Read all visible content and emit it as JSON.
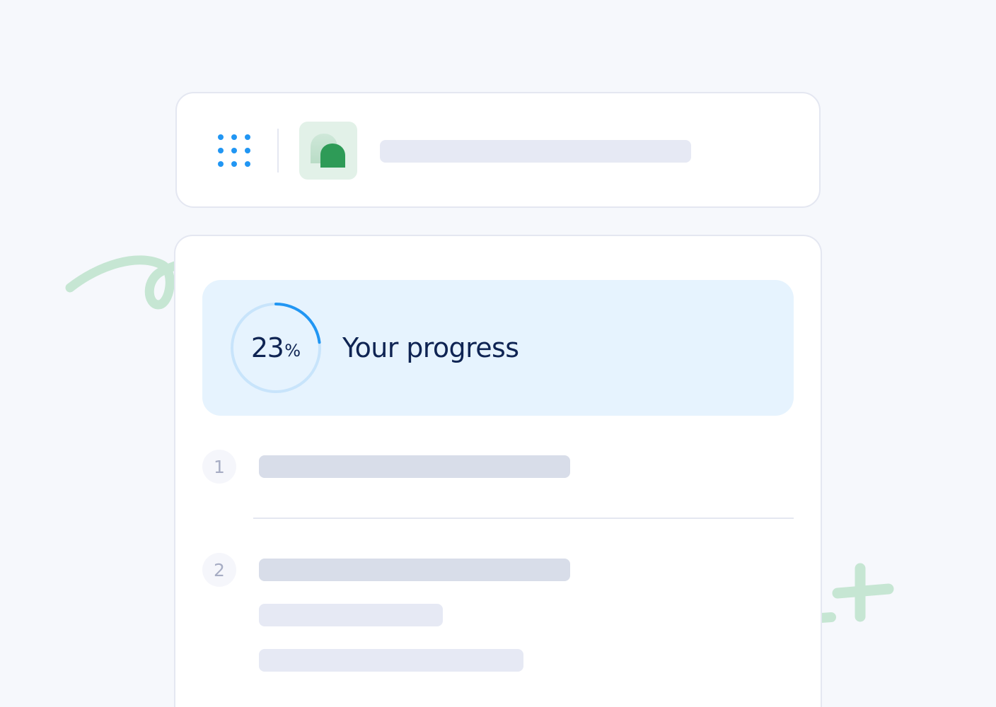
{
  "colors": {
    "page_background": "#f6f8fc",
    "card_background": "#ffffff",
    "card_border": "#e4e7f1",
    "accent_blue": "#2196f3",
    "ring_track": "#c8e4fb",
    "progress_panel": "#e6f3fe",
    "heading_text": "#0f2453",
    "skeleton_dark": "#d8dde9",
    "skeleton_light": "#e6e9f4",
    "badge_background": "#f5f6fb",
    "badge_text": "#a7adc4",
    "brand_green": "#2e9b57",
    "brand_green_light": "#e2f1e8",
    "decor_green": "#c6e6d3"
  },
  "header": {
    "apps_icon": "grid-dots-icon",
    "logo_icon": "green-speech-shape-logo"
  },
  "progress": {
    "percent": 23,
    "percent_value": "23",
    "percent_sign": "%",
    "title": "Your progress"
  },
  "steps": [
    {
      "number": "1"
    },
    {
      "number": "2"
    }
  ],
  "decorations": {
    "left": "green-swirl-icon",
    "right": "green-sparkle-icon"
  }
}
